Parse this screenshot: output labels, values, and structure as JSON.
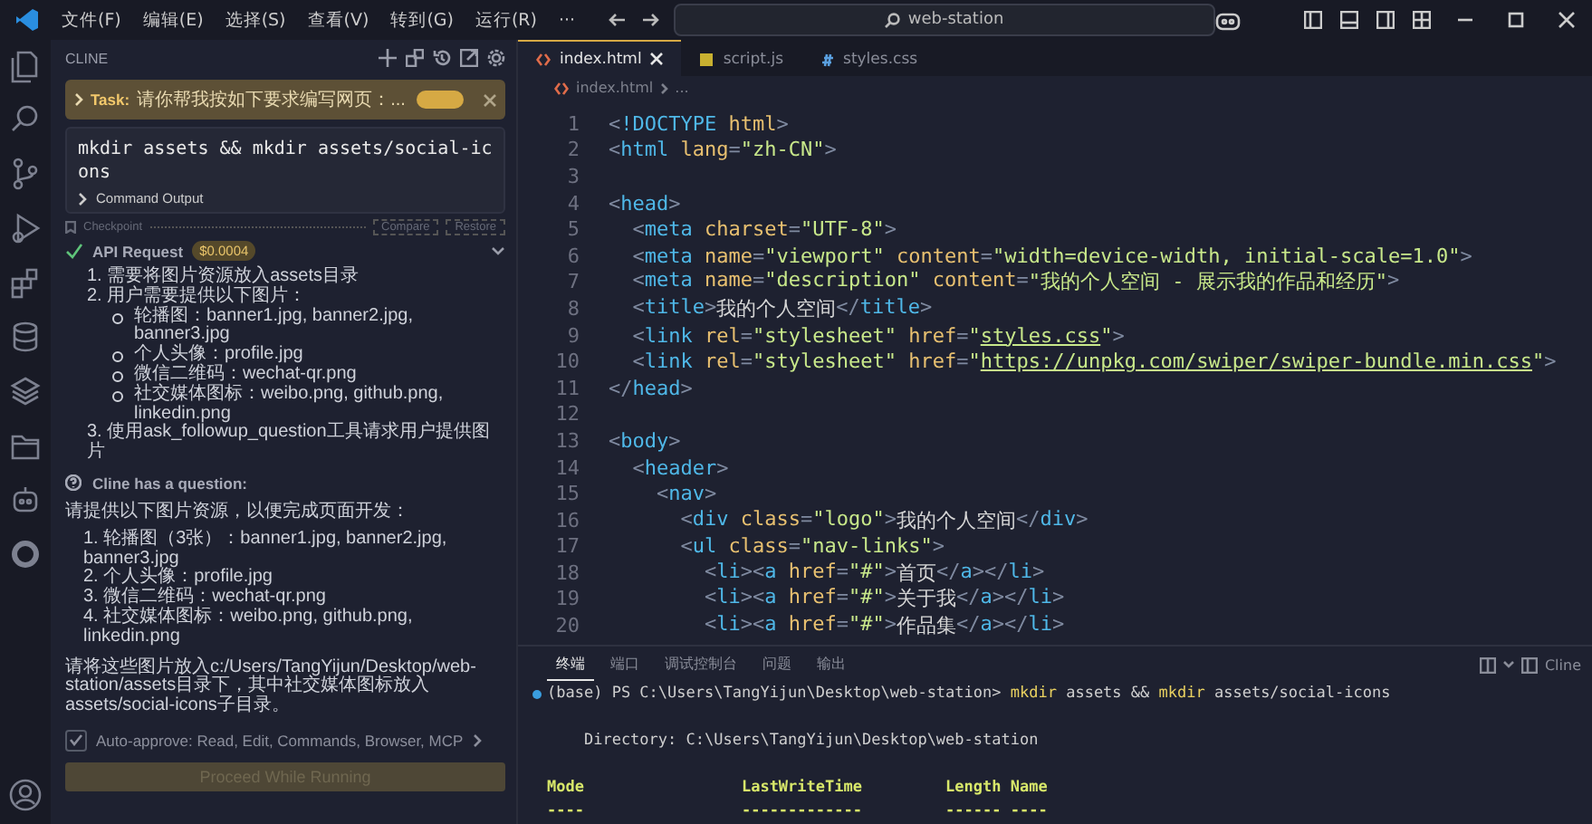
{
  "title_bar": {
    "menu": [
      "文件(F)",
      "编辑(E)",
      "选择(S)",
      "查看(V)",
      "转到(G)",
      "运行(R)",
      "···"
    ],
    "search": "web-station"
  },
  "activity_bar": {
    "items": [
      {
        "kind": "files",
        "selected": false
      },
      {
        "kind": "search",
        "selected": false
      },
      {
        "kind": "branch",
        "selected": false
      },
      {
        "kind": "run",
        "selected": false
      },
      {
        "kind": "extensions",
        "selected": false
      },
      {
        "kind": "database",
        "selected": false
      },
      {
        "kind": "layers",
        "selected": false
      },
      {
        "kind": "folder",
        "selected": false
      },
      {
        "kind": "robot",
        "selected": false
      },
      {
        "kind": "ring",
        "selected": false
      }
    ]
  },
  "sidebar": {
    "title": "CLINE",
    "task": {
      "label": "Task:",
      "text": "请你帮我按如下要求编写网页：..."
    },
    "command": {
      "text": "mkdir assets && mkdir assets/social-icons",
      "output_label": "Command Output"
    },
    "checkpoint": {
      "label": "Checkpoint",
      "buttons": [
        "Compare",
        "Restore"
      ]
    },
    "api_request": {
      "label": "API Request",
      "cost": "$0.0004"
    },
    "steps": [
      {
        "text": "1. 需要将图片资源放入assets目录"
      },
      {
        "text": "2. 用户需要提供以下图片：",
        "children": [
          {
            "text": "轮播图：banner1.jpg, banner2.jpg, banner3.jpg"
          },
          {
            "text": "个人头像：profile.jpg"
          },
          {
            "text": "微信二维码：wechat-qr.png"
          },
          {
            "text": "社交媒体图标：weibo.png, github.png, linkedin.png"
          }
        ]
      },
      {
        "text": "3. 使用ask_followup_question工具请求用户提供图片"
      }
    ],
    "question_label": "Cline has a question:",
    "question_intro": "请提供以下图片资源，以便完成页面开发：",
    "question_items": [
      "1. 轮播图（3张）：banner1.jpg, banner2.jpg, banner3.jpg",
      "2. 个人头像：profile.jpg",
      "3. 微信二维码：wechat-qr.png",
      "4. 社交媒体图标：weibo.png, github.png, linkedin.png"
    ],
    "question_outro": "请将这些图片放入c:/Users/TangYijun/Desktop/web-station/assets目录下，其中社交媒体图标放入assets/social-icons子目录。",
    "auto_approve": {
      "label": "Auto-approve: Read, Edit, Commands, Browser, MCP",
      "checked": true
    },
    "proceed_button": {
      "label": "Proceed While Running",
      "disabled": true
    }
  },
  "editor": {
    "tabs": [
      {
        "label": "index.html",
        "kind": "html",
        "selected": true
      },
      {
        "label": "script.js",
        "kind": "js",
        "selected": false
      },
      {
        "label": "styles.css",
        "kind": "css",
        "selected": false
      }
    ],
    "breadcrumb": [
      "index.html",
      "..."
    ],
    "lines": [
      {
        "n": "1",
        "tokens": [
          {
            "kind": "punct",
            "text": "<"
          },
          {
            "kind": "tag",
            "text": "!DOCTYPE"
          },
          {
            "kind": "attr",
            "text": " html"
          },
          {
            "kind": "punct",
            "text": ">"
          }
        ]
      },
      {
        "n": "2",
        "tokens": [
          {
            "kind": "punct",
            "text": "<"
          },
          {
            "kind": "tag",
            "text": "html"
          },
          {
            "kind": "attr",
            "text": " lang"
          },
          {
            "kind": "punct",
            "text": "="
          },
          {
            "kind": "str",
            "text": "\"zh-CN\""
          },
          {
            "kind": "punct",
            "text": ">"
          }
        ]
      },
      {
        "n": "3"
      },
      {
        "n": "4",
        "tokens": [
          {
            "kind": "punct",
            "text": "<"
          },
          {
            "kind": "tag",
            "text": "head"
          },
          {
            "kind": "punct",
            "text": ">"
          }
        ]
      },
      {
        "n": "5",
        "tokens": [
          {
            "kind": "punct",
            "text": "  <"
          },
          {
            "kind": "tag",
            "text": "meta"
          },
          {
            "kind": "attr",
            "text": " charset"
          },
          {
            "kind": "punct",
            "text": "="
          },
          {
            "kind": "str",
            "text": "\"UTF-8\""
          },
          {
            "kind": "punct",
            "text": ">"
          }
        ]
      },
      {
        "n": "6",
        "tokens": [
          {
            "kind": "punct",
            "text": "  <"
          },
          {
            "kind": "tag",
            "text": "meta"
          },
          {
            "kind": "attr",
            "text": " name"
          },
          {
            "kind": "punct",
            "text": "="
          },
          {
            "kind": "str",
            "text": "\"viewport\""
          },
          {
            "kind": "attr",
            "text": " content"
          },
          {
            "kind": "punct",
            "text": "="
          },
          {
            "kind": "str",
            "text": "\"width=device-width, initial-scale=1.0\""
          },
          {
            "kind": "punct",
            "text": ">"
          }
        ]
      },
      {
        "n": "7",
        "tokens": [
          {
            "kind": "punct",
            "text": "  <"
          },
          {
            "kind": "tag",
            "text": "meta"
          },
          {
            "kind": "attr",
            "text": " name"
          },
          {
            "kind": "punct",
            "text": "="
          },
          {
            "kind": "str",
            "text": "\"description\""
          },
          {
            "kind": "attr",
            "text": " content"
          },
          {
            "kind": "punct",
            "text": "="
          },
          {
            "kind": "str",
            "text": "\"我的个人空间 - 展示我的作品和经历\""
          },
          {
            "kind": "punct",
            "text": ">"
          }
        ]
      },
      {
        "n": "8",
        "tokens": [
          {
            "kind": "punct",
            "text": "  <"
          },
          {
            "kind": "tag",
            "text": "title"
          },
          {
            "kind": "punct",
            "text": ">"
          },
          {
            "kind": "text",
            "text": "我的个人空间"
          },
          {
            "kind": "punct",
            "text": "</"
          },
          {
            "kind": "tag",
            "text": "title"
          },
          {
            "kind": "punct",
            "text": ">"
          }
        ]
      },
      {
        "n": "9",
        "tokens": [
          {
            "kind": "punct",
            "text": "  <"
          },
          {
            "kind": "tag",
            "text": "link"
          },
          {
            "kind": "attr",
            "text": " rel"
          },
          {
            "kind": "punct",
            "text": "="
          },
          {
            "kind": "str",
            "text": "\"stylesheet\""
          },
          {
            "kind": "attr",
            "text": " href"
          },
          {
            "kind": "punct",
            "text": "="
          },
          {
            "kind": "str",
            "text": "\""
          },
          {
            "kind": "link",
            "text": "styles.css"
          },
          {
            "kind": "str",
            "text": "\""
          },
          {
            "kind": "punct",
            "text": ">"
          }
        ]
      },
      {
        "n": "10",
        "tokens": [
          {
            "kind": "punct",
            "text": "  <"
          },
          {
            "kind": "tag",
            "text": "link"
          },
          {
            "kind": "attr",
            "text": " rel"
          },
          {
            "kind": "punct",
            "text": "="
          },
          {
            "kind": "str",
            "text": "\"stylesheet\""
          },
          {
            "kind": "attr",
            "text": " href"
          },
          {
            "kind": "punct",
            "text": "="
          },
          {
            "kind": "str",
            "text": "\""
          },
          {
            "kind": "link",
            "text": "https://unpkg.com/swiper/swiper-bundle.min.css"
          },
          {
            "kind": "str",
            "text": "\""
          },
          {
            "kind": "punct",
            "text": ">"
          }
        ]
      },
      {
        "n": "11",
        "tokens": [
          {
            "kind": "punct",
            "text": "</"
          },
          {
            "kind": "tag",
            "text": "head"
          },
          {
            "kind": "punct",
            "text": ">"
          }
        ]
      },
      {
        "n": "12"
      },
      {
        "n": "13",
        "tokens": [
          {
            "kind": "punct",
            "text": "<"
          },
          {
            "kind": "tag",
            "text": "body"
          },
          {
            "kind": "punct",
            "text": ">"
          }
        ]
      },
      {
        "n": "14",
        "tokens": [
          {
            "kind": "punct",
            "text": "  <"
          },
          {
            "kind": "tag",
            "text": "header"
          },
          {
            "kind": "punct",
            "text": ">"
          }
        ]
      },
      {
        "n": "15",
        "tokens": [
          {
            "kind": "punct",
            "text": "    <"
          },
          {
            "kind": "tag",
            "text": "nav"
          },
          {
            "kind": "punct",
            "text": ">"
          }
        ]
      },
      {
        "n": "16",
        "tokens": [
          {
            "kind": "punct",
            "text": "      <"
          },
          {
            "kind": "tag",
            "text": "div"
          },
          {
            "kind": "attr",
            "text": " class"
          },
          {
            "kind": "punct",
            "text": "="
          },
          {
            "kind": "str",
            "text": "\"logo\""
          },
          {
            "kind": "punct",
            "text": ">"
          },
          {
            "kind": "text",
            "text": "我的个人空间"
          },
          {
            "kind": "punct",
            "text": "</"
          },
          {
            "kind": "tag",
            "text": "div"
          },
          {
            "kind": "punct",
            "text": ">"
          }
        ]
      },
      {
        "n": "17",
        "tokens": [
          {
            "kind": "punct",
            "text": "      <"
          },
          {
            "kind": "tag",
            "text": "ul"
          },
          {
            "kind": "attr",
            "text": " class"
          },
          {
            "kind": "punct",
            "text": "="
          },
          {
            "kind": "str",
            "text": "\"nav-links\""
          },
          {
            "kind": "punct",
            "text": ">"
          }
        ]
      },
      {
        "n": "18",
        "tokens": [
          {
            "kind": "punct",
            "text": "        <"
          },
          {
            "kind": "tag",
            "text": "li"
          },
          {
            "kind": "punct",
            "text": "><"
          },
          {
            "kind": "tag",
            "text": "a"
          },
          {
            "kind": "attr",
            "text": " href"
          },
          {
            "kind": "punct",
            "text": "="
          },
          {
            "kind": "str",
            "text": "\"#\""
          },
          {
            "kind": "punct",
            "text": ">"
          },
          {
            "kind": "text",
            "text": "首页"
          },
          {
            "kind": "punct",
            "text": "</"
          },
          {
            "kind": "tag",
            "text": "a"
          },
          {
            "kind": "punct",
            "text": "></"
          },
          {
            "kind": "tag",
            "text": "li"
          },
          {
            "kind": "punct",
            "text": ">"
          }
        ]
      },
      {
        "n": "19",
        "tokens": [
          {
            "kind": "punct",
            "text": "        <"
          },
          {
            "kind": "tag",
            "text": "li"
          },
          {
            "kind": "punct",
            "text": "><"
          },
          {
            "kind": "tag",
            "text": "a"
          },
          {
            "kind": "attr",
            "text": " href"
          },
          {
            "kind": "punct",
            "text": "="
          },
          {
            "kind": "str",
            "text": "\"#\""
          },
          {
            "kind": "punct",
            "text": ">"
          },
          {
            "kind": "text",
            "text": "关于我"
          },
          {
            "kind": "punct",
            "text": "</"
          },
          {
            "kind": "tag",
            "text": "a"
          },
          {
            "kind": "punct",
            "text": "></"
          },
          {
            "kind": "tag",
            "text": "li"
          },
          {
            "kind": "punct",
            "text": ">"
          }
        ]
      },
      {
        "n": "20",
        "tokens": [
          {
            "kind": "punct",
            "text": "        <"
          },
          {
            "kind": "tag",
            "text": "li"
          },
          {
            "kind": "punct",
            "text": "><"
          },
          {
            "kind": "tag",
            "text": "a"
          },
          {
            "kind": "attr",
            "text": " href"
          },
          {
            "kind": "punct",
            "text": "="
          },
          {
            "kind": "str",
            "text": "\"#\""
          },
          {
            "kind": "punct",
            "text": ">"
          },
          {
            "kind": "text",
            "text": "作品集"
          },
          {
            "kind": "punct",
            "text": "</"
          },
          {
            "kind": "tag",
            "text": "a"
          },
          {
            "kind": "punct",
            "text": "></"
          },
          {
            "kind": "tag",
            "text": "li"
          },
          {
            "kind": "punct",
            "text": ">"
          }
        ]
      }
    ]
  },
  "panel": {
    "tabs": [
      {
        "label": "终端",
        "selected": true
      },
      {
        "label": "端口",
        "selected": false
      },
      {
        "label": "调试控制台",
        "selected": false
      },
      {
        "label": "问题",
        "selected": false
      },
      {
        "label": "输出",
        "selected": false
      }
    ],
    "right_label": "Cline",
    "terminal_lines": [
      {
        "kind": "prompt",
        "tokens": [
          {
            "kind": "plain",
            "text": "(base) PS C:\\Users\\TangYijun\\Desktop\\web-station> "
          },
          {
            "kind": "command",
            "text": "mkdir"
          },
          {
            "kind": "plain",
            "text": " assets && "
          },
          {
            "kind": "command",
            "text": "mkdir"
          },
          {
            "kind": "plain",
            "text": " assets/social-icons"
          }
        ]
      },
      {
        "kind": "blank"
      },
      {
        "kind": "output",
        "tokens": [
          {
            "kind": "plain",
            "text": "    Directory: C:\\Users\\TangYijun\\Desktop\\web-station"
          }
        ]
      },
      {
        "kind": "blank"
      },
      {
        "kind": "output",
        "tokens": [
          {
            "kind": "header",
            "text": "Mode                 LastWriteTime         Length Name"
          }
        ]
      },
      {
        "kind": "output",
        "tokens": [
          {
            "kind": "header",
            "text": "----                 -------------         ------ ----"
          }
        ]
      }
    ]
  }
}
